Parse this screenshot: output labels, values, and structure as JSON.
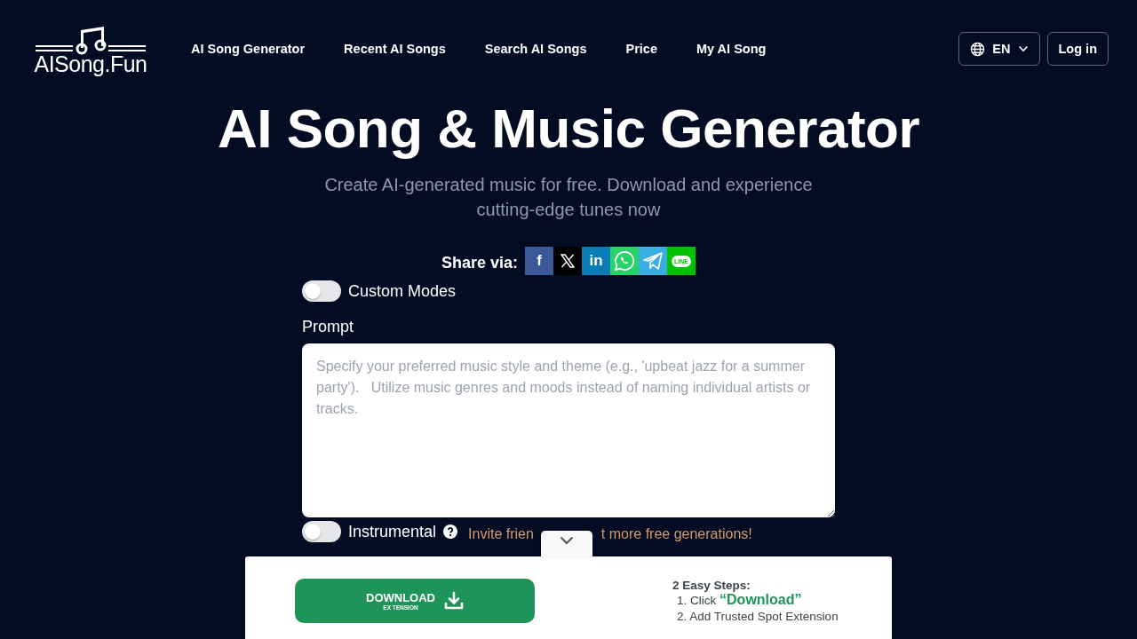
{
  "header": {
    "logo_text": "AISong.Fun",
    "nav": [
      "AI Song Generator",
      "Recent AI Songs",
      "Search AI Songs",
      "Price",
      "My AI Song"
    ],
    "language": "EN",
    "login": "Log in"
  },
  "hero": {
    "title": "AI Song & Music Generator",
    "subtitle": "Create AI-generated music for free. Download and experience cutting-edge tunes now"
  },
  "share": {
    "label": "Share via:",
    "buttons": [
      {
        "kind": "facebook",
        "glyph": "f"
      },
      {
        "kind": "x"
      },
      {
        "kind": "linkedin",
        "glyph": "in"
      },
      {
        "kind": "whatsapp"
      },
      {
        "kind": "telegram"
      },
      {
        "kind": "line",
        "glyph": "LINE"
      }
    ]
  },
  "form": {
    "custom_modes": {
      "label": "Custom Modes",
      "on": false
    },
    "prompt_label": "Prompt",
    "prompt_placeholder": "Specify your preferred music style and theme (e.g., 'upbeat jazz for a summer party').   Utilize music genres and moods instead of naming individual artists or tracks.",
    "instrumental": {
      "label": "Instrumental",
      "on": false
    },
    "invite_parts": [
      "Invite frien",
      "t more free generations!"
    ]
  },
  "banner": {
    "button_label": "DOWNLOAD",
    "button_sublabel": "EX TENSION",
    "steps_title": "2 Easy Steps:",
    "steps": [
      {
        "number": "1.",
        "text": "Click",
        "highlight": "“Download”"
      },
      {
        "number": "2.",
        "text": "Add Trusted Spot Extension"
      }
    ]
  }
}
